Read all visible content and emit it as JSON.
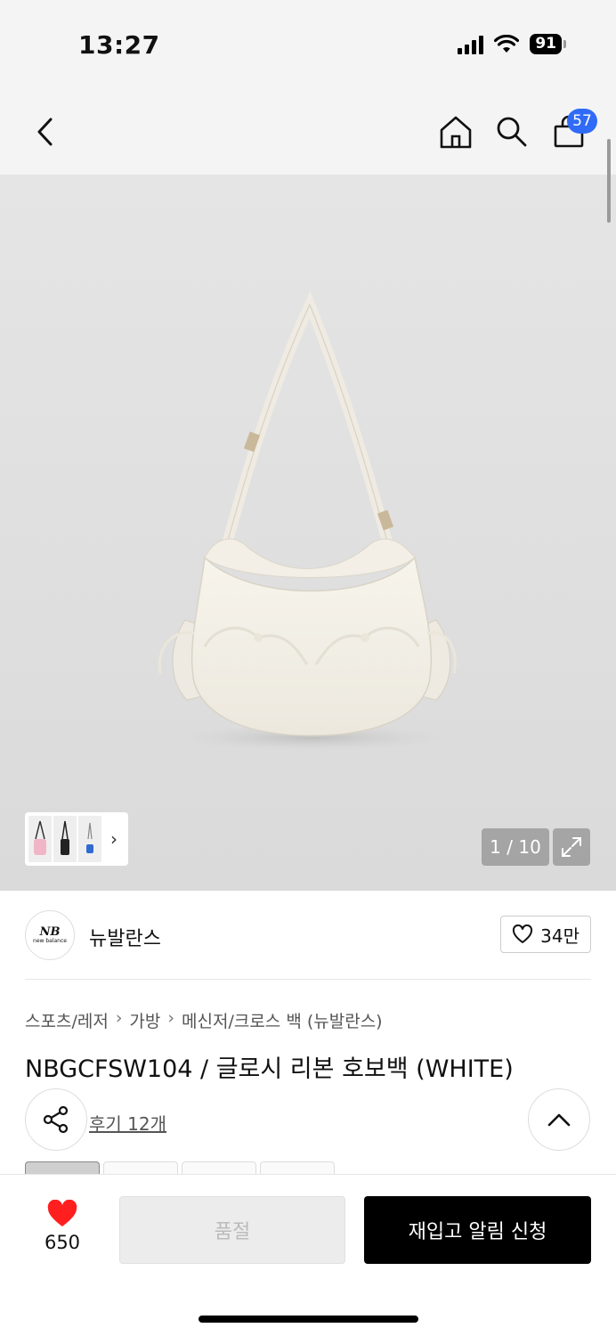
{
  "status": {
    "time": "13:27",
    "battery": "91"
  },
  "nav": {
    "cart_count": "57"
  },
  "gallery": {
    "page_indicator": "1 / 10",
    "thumb_arrow": "›"
  },
  "brand": {
    "name": "뉴발란스",
    "logo_text": "new balance",
    "likes": "34만"
  },
  "breadcrumb": [
    "스포츠/레저",
    "가방",
    "메신저/크로스 백 (뉴발란스)"
  ],
  "product": {
    "title": "NBGCFSW104 / 글로시 리본 호보백 (WHITE)"
  },
  "reviews": {
    "label": "후기 12개"
  },
  "bottom": {
    "heart_count": "650",
    "soldout_label": "품절",
    "restock_label": "재입고 알림 신청"
  },
  "colors": {
    "accent_blue": "#2f6bf6",
    "heart_red": "#ff1f1f",
    "primary_black": "#000000"
  }
}
